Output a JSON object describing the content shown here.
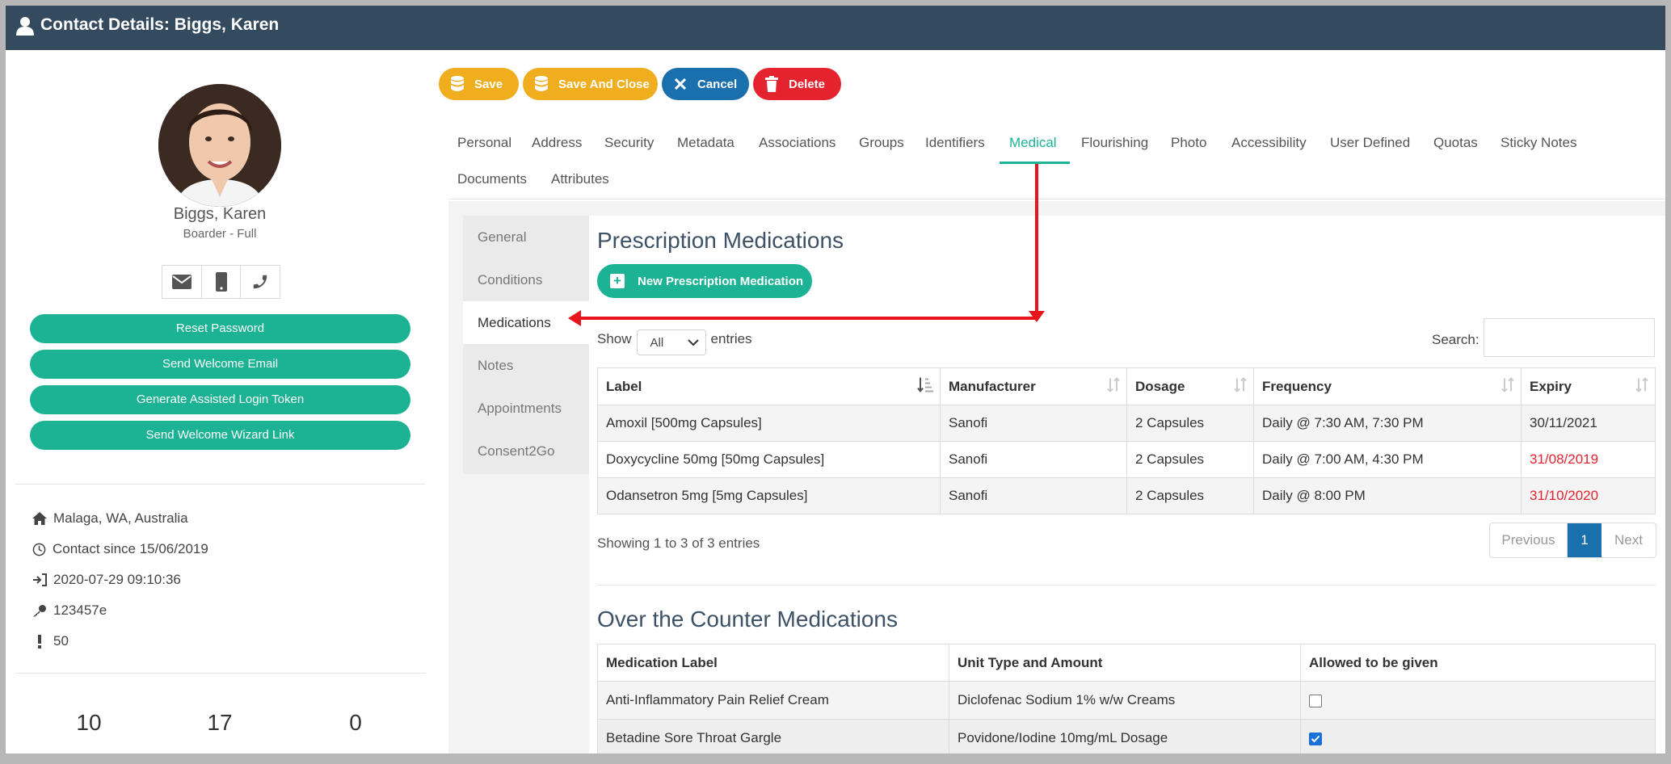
{
  "window": {
    "title": "Contact Details: Biggs, Karen"
  },
  "profile": {
    "name": "Biggs, Karen",
    "subtitle": "Boarder - Full",
    "buttons": {
      "reset_password": "Reset Password",
      "send_welcome_email": "Send Welcome Email",
      "generate_token": "Generate Assisted Login Token",
      "send_wizard_link": "Send Welcome Wizard Link"
    },
    "info": {
      "location": "Malaga, WA, Australia",
      "contact_since": "Contact since 15/06/2019",
      "last_login": "2020-07-29 09:10:36",
      "key": "123457e",
      "alert": "50"
    },
    "stats": [
      "10",
      "17",
      "0"
    ]
  },
  "toolbar": {
    "save": "Save",
    "save_and_close": "Save And Close",
    "cancel": "Cancel",
    "delete": "Delete"
  },
  "tabs": {
    "personal": "Personal",
    "address": "Address",
    "security": "Security",
    "metadata": "Metadata",
    "associations": "Associations",
    "groups": "Groups",
    "identifiers": "Identifiers",
    "medical": "Medical",
    "flourishing": "Flourishing",
    "photo": "Photo",
    "accessibility": "Accessibility",
    "user_defined": "User Defined",
    "quotas": "Quotas",
    "sticky_notes": "Sticky Notes",
    "documents": "Documents",
    "attributes": "Attributes"
  },
  "subnav": {
    "general": "General",
    "conditions": "Conditions",
    "medications": "Medications",
    "notes": "Notes",
    "appointments": "Appointments",
    "consent2go": "Consent2Go"
  },
  "prescription": {
    "heading": "Prescription Medications",
    "new_button": "New Prescription Medication",
    "show_label": "Show",
    "show_value": "All",
    "entries_label": "entries",
    "search_label": "Search:",
    "columns": {
      "label": "Label",
      "manufacturer": "Manufacturer",
      "dosage": "Dosage",
      "frequency": "Frequency",
      "expiry": "Expiry"
    },
    "rows": [
      {
        "label": "Amoxil [500mg Capsules]",
        "manufacturer": "Sanofi",
        "dosage": "2 Capsules",
        "frequency": "Daily @ 7:30 AM, 7:30 PM",
        "expiry": "30/11/2021"
      },
      {
        "label": "Doxycycline 50mg [50mg Capsules]",
        "manufacturer": "Sanofi",
        "dosage": "2 Capsules",
        "frequency": "Daily @ 7:00 AM, 4:30 PM",
        "expiry": "31/08/2019"
      },
      {
        "label": "Odansetron 5mg [5mg Capsules]",
        "manufacturer": "Sanofi",
        "dosage": "2 Capsules",
        "frequency": "Daily @ 8:00 PM",
        "expiry": "31/10/2020"
      }
    ],
    "showing": "Showing 1 to 3 of 3 entries",
    "pager": {
      "previous": "Previous",
      "page": "1",
      "next": "Next"
    }
  },
  "otc": {
    "heading": "Over the Counter Medications",
    "columns": {
      "medication_label": "Medication Label",
      "unit_type": "Unit Type and Amount",
      "allowed": "Allowed to be given"
    },
    "rows": [
      {
        "label": "Anti-Inflammatory Pain Relief Cream",
        "unit": "Diclofenac Sodium 1% w/w Creams",
        "allowed": false
      },
      {
        "label": "Betadine Sore Throat Gargle",
        "unit": "Povidone/Iodine 10mg/mL Dosage",
        "allowed": true
      }
    ]
  },
  "colors": {
    "title_bar": "#344a5e",
    "accent_green": "#1cb394",
    "save_yellow": "#f0ad1e",
    "cancel_blue": "#1a6fad",
    "delete_red": "#e5232f",
    "annotation_arrow": "#e8161c"
  }
}
